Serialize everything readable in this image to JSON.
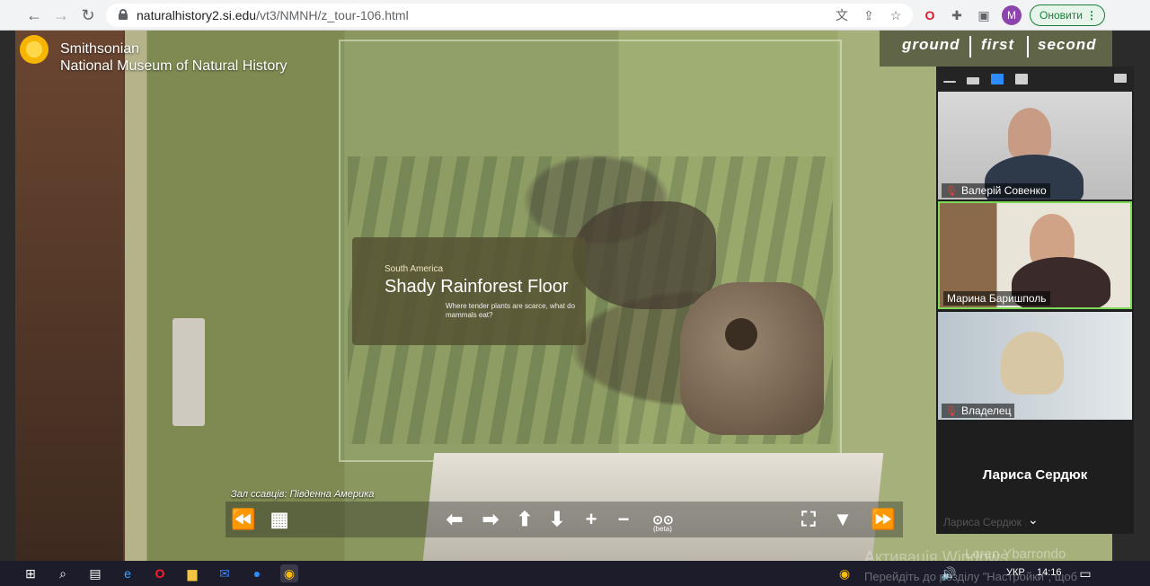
{
  "browser": {
    "url_host": "naturalhistory2.si.edu",
    "url_path": "/vt3/NMNH/z_tour-106.html",
    "update_label": "Оновити",
    "profile_initial": "M",
    "icons": [
      "back-icon",
      "forward-icon",
      "reload-icon",
      "lock-icon",
      "translate-icon",
      "share-icon",
      "star-icon",
      "opera-icon",
      "extensions-icon",
      "sidebar-icon",
      "more-icon"
    ]
  },
  "tour": {
    "logo_line1": "Smithsonian",
    "logo_line2": "National Museum of Natural History",
    "floors": [
      "ground",
      "first",
      "second"
    ],
    "exhibit_subtitle": "South America",
    "exhibit_title": "Shady Rainforest Floor",
    "exhibit_desc": "Where tender plants are scarce, what do mammals eat?",
    "caption": "Зал ссавців: Південна Америка",
    "toolbar": {
      "rewind": "⏪",
      "grid": "▦",
      "left": "⬅",
      "right": "➡",
      "up": "⬆",
      "down": "⬇",
      "zoom_in": "+",
      "zoom_out": "−",
      "vr": "⊙⊙",
      "vr_beta": "(beta)",
      "fullscreen": "⛶",
      "hide": "▼",
      "forward": "⏩"
    }
  },
  "zoom": {
    "participants": [
      {
        "name": "Валерій Совенко",
        "muted": true
      },
      {
        "name": "Марина Баришполь",
        "muted": false
      },
      {
        "name": "Владелец",
        "muted": true
      },
      {
        "name": "Лариса Сердюк",
        "muted": false
      }
    ],
    "ghost_label": "Лариса Сердюк",
    "ghost_name2": "Loren Ybarrondo"
  },
  "windows": {
    "activation_line1": "Активація Windows",
    "activation_line2": "Перейдіть до розділу \"Настройки\", щоб",
    "lang": "УКР",
    "time": "14:16"
  }
}
